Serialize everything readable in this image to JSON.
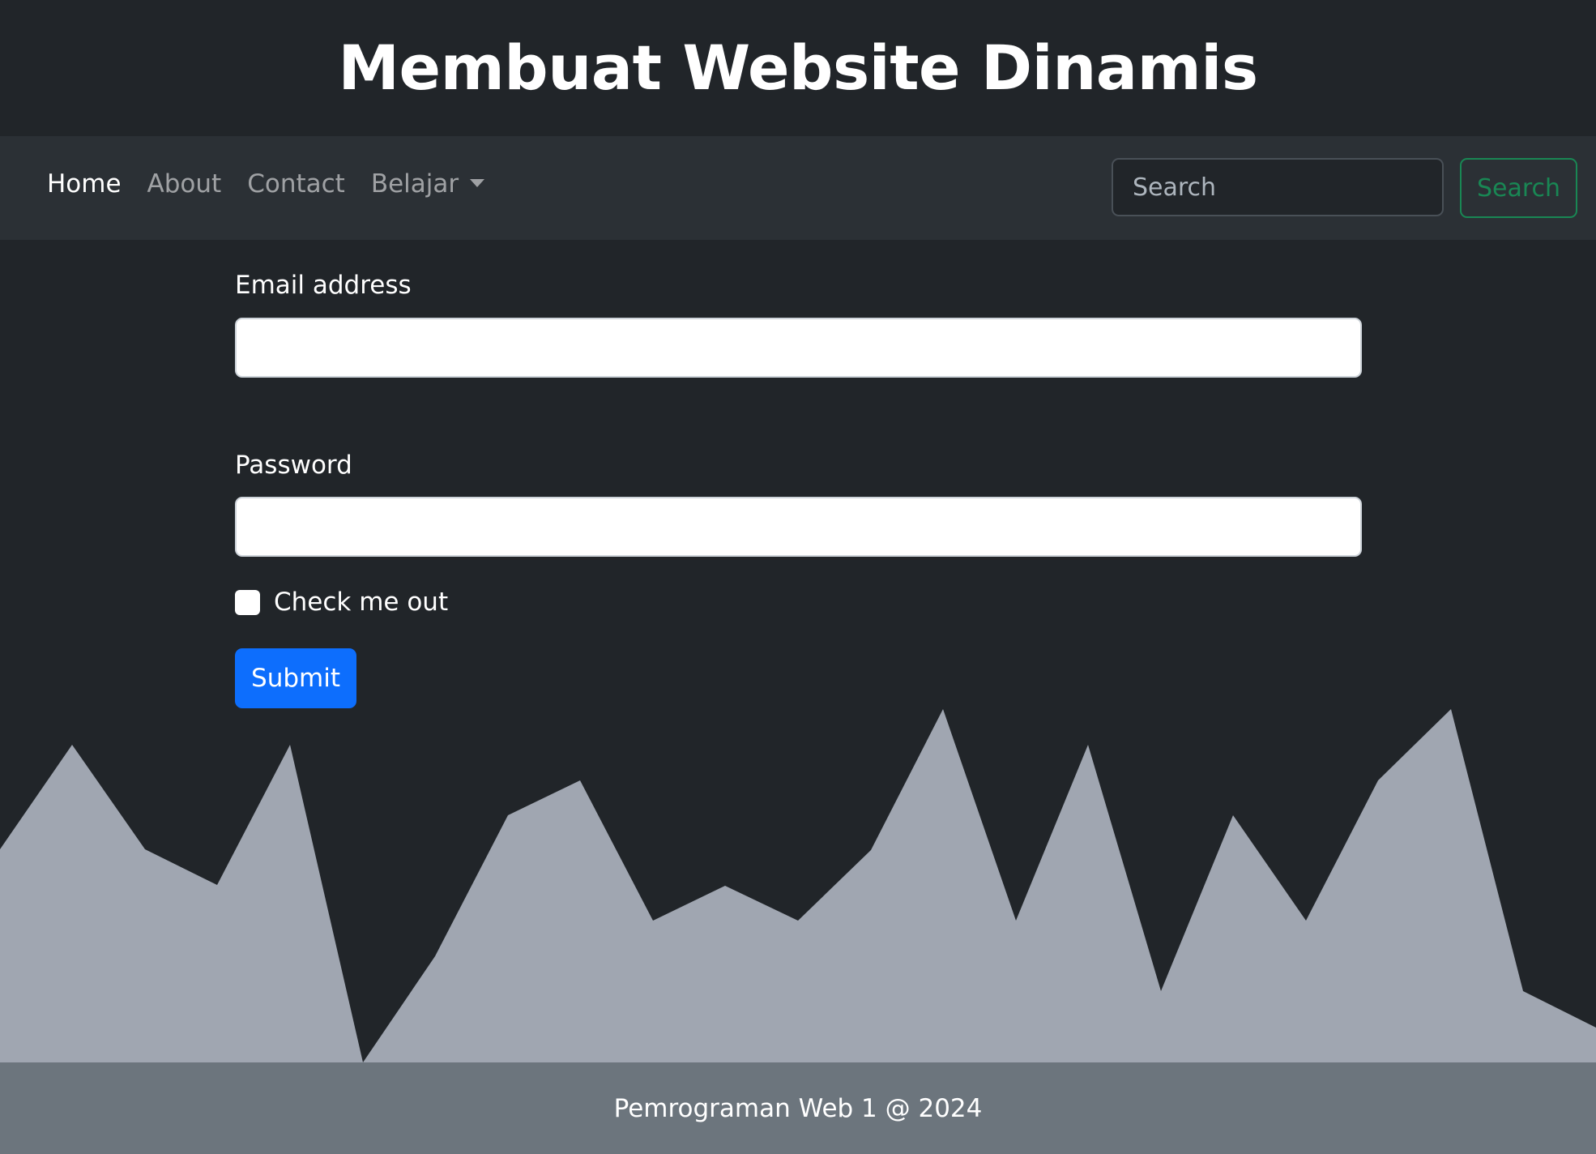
{
  "header": {
    "title": "Membuat Website Dinamis"
  },
  "nav": {
    "links": [
      {
        "label": "Home"
      },
      {
        "label": "About"
      },
      {
        "label": "Contact"
      },
      {
        "label": "Belajar"
      }
    ],
    "search": {
      "placeholder": "Search",
      "value": "",
      "button_label": "Search"
    }
  },
  "form": {
    "email_label": "Email address",
    "email_value": "",
    "password_label": "Password",
    "password_value": "",
    "checkbox_label": "Check me out",
    "checkbox_checked": false,
    "submit_label": "Submit"
  },
  "footer": {
    "text": "Pemrograman Web 1 @ 2024"
  },
  "colors": {
    "page_bg": "#212529",
    "navbar_bg": "#2b3035",
    "primary": "#0d6efd",
    "success": "#198754",
    "wave": "#a0a6b1",
    "footer_bg": "#6c757d"
  }
}
